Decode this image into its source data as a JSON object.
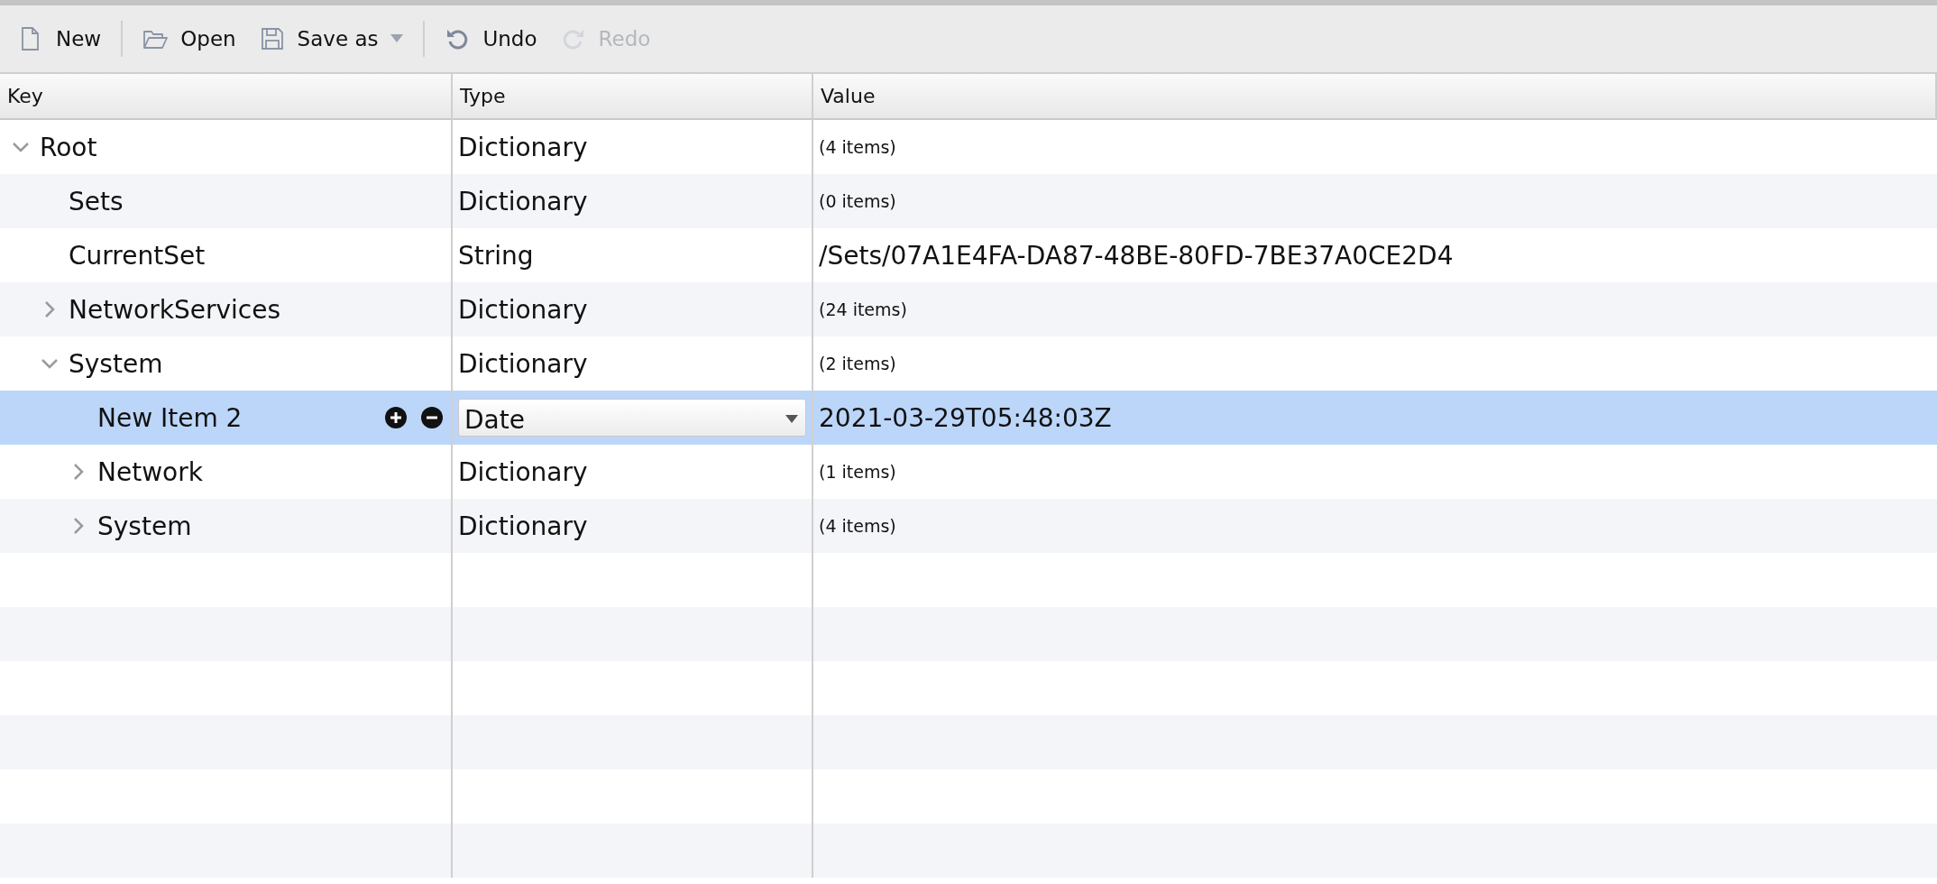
{
  "toolbar": {
    "groups": [
      [
        {
          "kind": "new",
          "label": "New",
          "disabled": false,
          "has_menu": false
        }
      ],
      [
        {
          "kind": "open",
          "label": "Open",
          "disabled": false,
          "has_menu": false
        },
        {
          "kind": "save",
          "label": "Save as",
          "disabled": false,
          "has_menu": true
        }
      ],
      [
        {
          "kind": "undo",
          "label": "Undo",
          "disabled": false,
          "has_menu": false
        },
        {
          "kind": "redo",
          "label": "Redo",
          "disabled": true,
          "has_menu": false
        }
      ]
    ]
  },
  "table": {
    "columns": [
      "Key",
      "Type",
      "Value"
    ],
    "rows": [
      {
        "key": "Root",
        "type": "Dictionary",
        "value": "(4 items)",
        "kind": "container",
        "expanded": true,
        "selected": false,
        "children": [
          {
            "key": "Sets",
            "type": "Dictionary",
            "value": "(0 items)",
            "kind": "container",
            "selected": false
          },
          {
            "key": "CurrentSet",
            "type": "String",
            "value": "/Sets/07A1E4FA-DA87-48BE-80FD-7BE37A0CE2D4",
            "kind": "leaf",
            "selected": false
          },
          {
            "key": "NetworkServices",
            "type": "Dictionary",
            "value": "(24 items)",
            "kind": "container",
            "expanded": false,
            "selected": false
          },
          {
            "key": "System",
            "type": "Dictionary",
            "value": "(2 items)",
            "kind": "container",
            "expanded": true,
            "selected": false,
            "children": [
              {
                "key": "New Item 2",
                "type": "Date",
                "value": "2021-03-29T05:48:03Z",
                "kind": "leaf",
                "selected": true
              },
              {
                "key": "Network",
                "type": "Dictionary",
                "value": "(1 items)",
                "kind": "container",
                "expanded": false,
                "selected": false
              },
              {
                "key": "System",
                "type": "Dictionary",
                "value": "(4 items)",
                "kind": "container",
                "expanded": false,
                "selected": false
              }
            ]
          }
        ]
      }
    ]
  }
}
